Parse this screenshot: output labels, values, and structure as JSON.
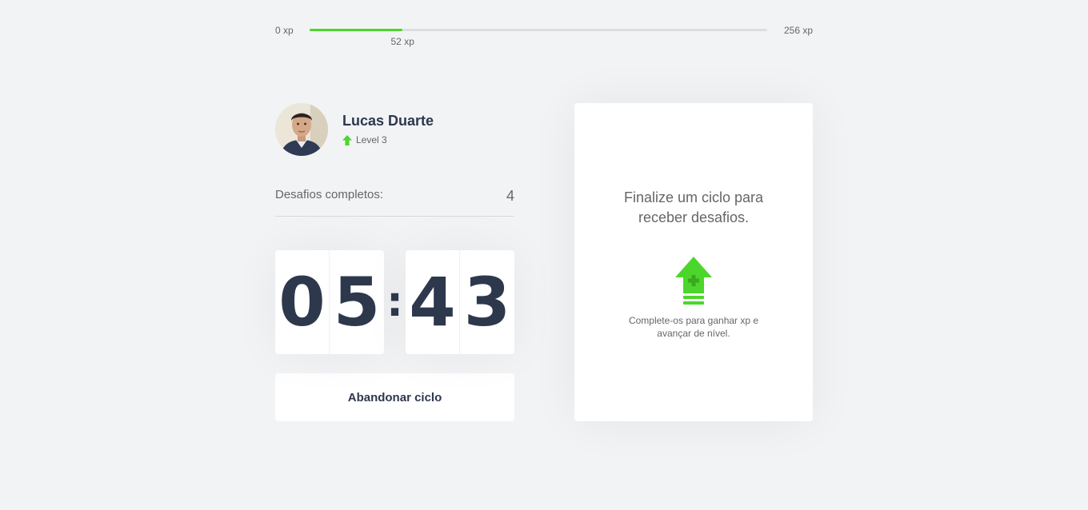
{
  "xp": {
    "min_label": "0 xp",
    "max_label": "256 xp",
    "current_label": "52 xp",
    "current": 52,
    "max": 256
  },
  "profile": {
    "name": "Lucas Duarte",
    "level_label": "Level 3",
    "avatar_icon": "user-photo"
  },
  "challenges": {
    "label": "Desafios completos:",
    "count": "4"
  },
  "countdown": {
    "minute_left": "0",
    "minute_right": "5",
    "separator": ":",
    "second_left": "4",
    "second_right": "3"
  },
  "actions": {
    "abandon_label": "Abandonar ciclo"
  },
  "card": {
    "title": "Finalize um ciclo para receber desafios.",
    "hint": "Complete-os para ganhar xp e avançar de nível.",
    "icon": "level-up-icon"
  },
  "colors": {
    "accent_green": "#4cd62b",
    "title_dark": "#2e384d",
    "text": "#666666",
    "background": "#f2f3f5"
  }
}
